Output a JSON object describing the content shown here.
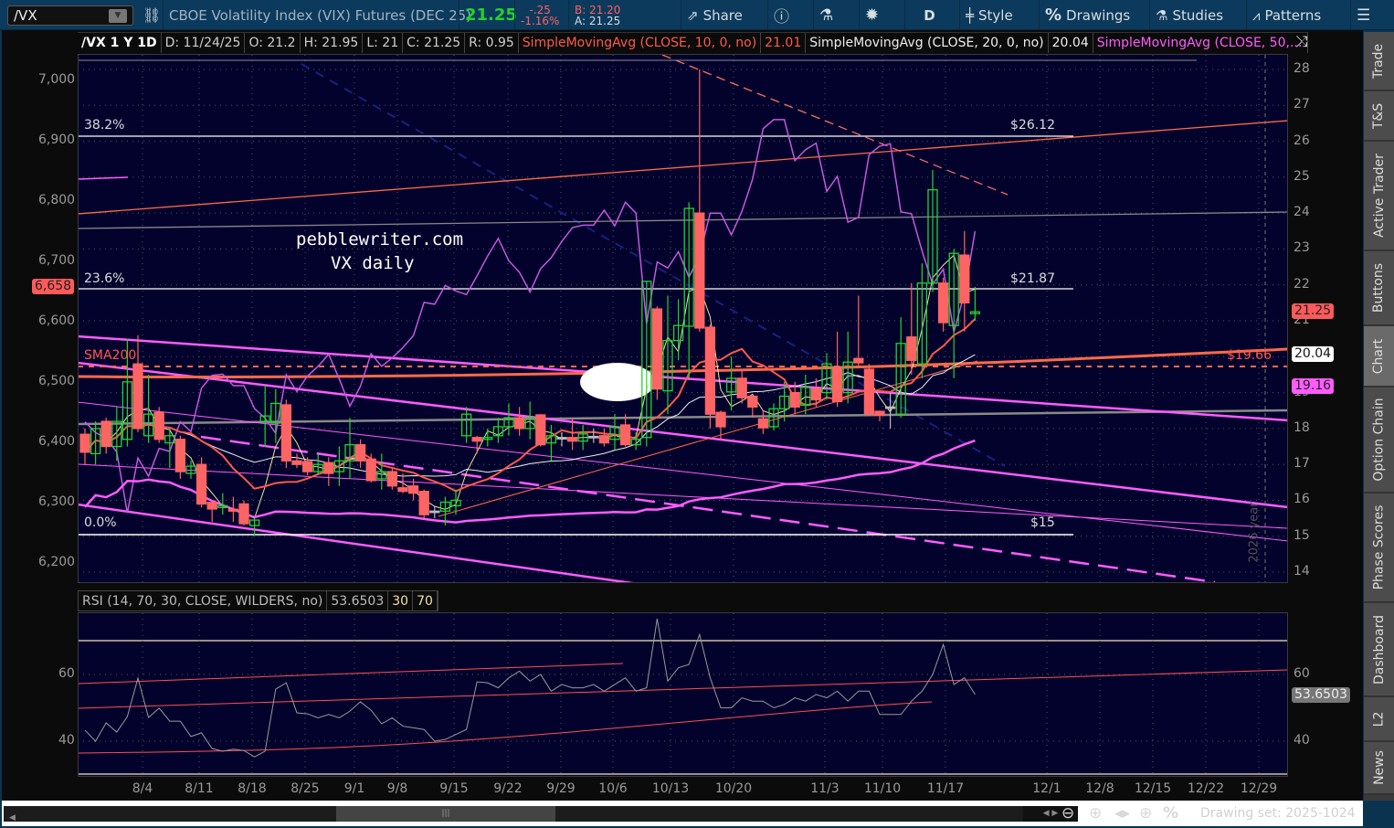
{
  "toolbar": {
    "symbol": "/VX",
    "description": "CBOE Volatility Index (VIX) Futures (DEC 25)",
    "last": "21.25",
    "change": "-.25",
    "change_pct": "-1.16%",
    "bid": "B: 21.20",
    "ask": "A: 21.25",
    "share": "Share",
    "period": "D",
    "style": "Style",
    "drawings": "Drawings",
    "studies": "Studies",
    "patterns": "Patterns"
  },
  "info": {
    "title": "/VX 1 Y 1D",
    "date": "D: 11/24/25",
    "open": "O: 21.2",
    "high": "H: 21.95",
    "low": "L: 21",
    "close": "C: 21.25",
    "range": "R: 0.95",
    "sma10_label": "SimpleMovingAvg (CLOSE, 10, 0, no)",
    "sma10_value": "21.01",
    "sma20_label": "SimpleMovingAvg (CLOSE, 20, 0, no)",
    "sma20_value": "20.04",
    "sma50_label": "SimpleMovingAvg (CLOSE, 50,..."
  },
  "colors": {
    "up": "#22d32c",
    "down": "#ff6464",
    "sma10": "#ff5a4a",
    "sma20": "#f0f0f0",
    "sma50": "#ff5cff",
    "overlay": "#c558e0",
    "bg": "#03022c"
  },
  "axes": {
    "right": [
      "28",
      "27",
      "26",
      "25",
      "24",
      "23",
      "22",
      "21",
      "20",
      "19",
      "18",
      "17",
      "16",
      "15",
      "14"
    ],
    "left": [
      "7,000",
      "6,900",
      "6,800",
      "6,700",
      "6,600",
      "6,500",
      "6,400",
      "6,300",
      "6,200"
    ],
    "rsi": [
      "60",
      "40"
    ],
    "dates": [
      "8/4",
      "8/11",
      "8/18",
      "8/25",
      "9/1",
      "9/8",
      "9/15",
      "9/22",
      "9/29",
      "10/6",
      "10/13",
      "10/20",
      "11/3",
      "11/10",
      "11/17",
      "12/1",
      "12/8",
      "12/15",
      "12/22",
      "12/29"
    ]
  },
  "badges": {
    "last": "21.25",
    "sma20": "20.04",
    "sma50": "19.16",
    "left_price": "6,658",
    "rsi": "53.6503"
  },
  "annotations": {
    "fib_382": "38.2%",
    "fib_382_price": "$26.12",
    "fib_236": "23.6%",
    "fib_236_price": "$21.87",
    "fib_0": "0.0%",
    "fib_0_price": "$15",
    "level": "$19.66",
    "sma200": "SMA200",
    "watermark1": "pebblewriter.com",
    "watermark2": "VX daily",
    "year": "2026 year"
  },
  "rsi_header": {
    "label": "RSI (14, 70, 30, CLOSE, WILDERS, no)",
    "value": "53.6503",
    "low": "30",
    "high": "70"
  },
  "chart_data": {
    "type": "candlestick",
    "symbol": "/VX",
    "ylim": [
      14,
      28
    ],
    "overlay_ylim": [
      6200,
      7000
    ],
    "candles": [
      [
        17.84,
        18.0,
        17.0,
        17.34
      ],
      [
        17.3,
        18.2,
        17.0,
        18.0
      ],
      [
        18.2,
        18.3,
        17.3,
        17.5
      ],
      [
        17.5,
        18.6,
        17.1,
        18.2
      ],
      [
        17.7,
        20.5,
        17.5,
        19.3
      ],
      [
        19.8,
        20.6,
        17.9,
        18.0
      ],
      [
        17.8,
        19.5,
        17.6,
        18.4
      ],
      [
        18.45,
        18.6,
        17.6,
        17.7
      ],
      [
        17.6,
        18.0,
        16.9,
        17.8
      ],
      [
        17.7,
        17.8,
        16.6,
        16.8
      ],
      [
        16.75,
        17.1,
        16.6,
        16.95
      ],
      [
        17.0,
        17.2,
        15.8,
        15.9
      ],
      [
        15.94,
        16.0,
        15.4,
        15.76
      ],
      [
        15.8,
        16.2,
        15.6,
        15.85
      ],
      [
        15.75,
        16.1,
        15.4,
        15.7
      ],
      [
        15.9,
        16.0,
        15.3,
        15.35
      ],
      [
        15.3,
        15.5,
        15.0,
        15.45
      ],
      [
        18.2,
        19.2,
        17.5,
        18.35
      ],
      [
        18.15,
        19.1,
        17.6,
        18.7
      ],
      [
        18.66,
        18.8,
        16.9,
        17.1
      ],
      [
        17.1,
        17.3,
        16.9,
        17.0
      ],
      [
        17.08,
        17.2,
        16.7,
        16.8
      ],
      [
        16.8,
        17.3,
        16.7,
        17.0
      ],
      [
        17.05,
        17.2,
        16.4,
        16.75
      ],
      [
        16.8,
        17.5,
        16.4,
        17.1
      ],
      [
        17.1,
        18.3,
        16.6,
        17.55
      ],
      [
        17.55,
        17.7,
        16.9,
        17.1
      ],
      [
        17.15,
        17.3,
        16.5,
        16.55
      ],
      [
        16.6,
        17.3,
        16.3,
        16.8
      ],
      [
        16.8,
        16.9,
        16.3,
        16.4
      ],
      [
        16.35,
        16.75,
        16.2,
        16.25
      ],
      [
        16.4,
        16.6,
        16.0,
        16.2
      ],
      [
        16.25,
        16.3,
        15.5,
        15.6
      ],
      [
        15.7,
        15.85,
        15.5,
        15.7
      ],
      [
        15.7,
        16.1,
        15.3,
        15.95
      ],
      [
        15.85,
        16.3,
        15.6,
        16.0
      ],
      [
        17.8,
        18.6,
        17.6,
        18.4
      ],
      [
        17.75,
        17.8,
        17.3,
        17.65
      ],
      [
        17.7,
        18.0,
        17.5,
        17.75
      ],
      [
        17.8,
        18.3,
        17.6,
        18.05
      ],
      [
        18.05,
        18.7,
        17.8,
        18.3
      ],
      [
        18.3,
        18.6,
        17.8,
        18.0
      ],
      [
        18.0,
        18.75,
        17.7,
        18.3
      ],
      [
        18.38,
        18.4,
        17.5,
        17.55
      ],
      [
        17.6,
        18.1,
        17.1,
        17.8
      ],
      [
        17.75,
        17.9,
        17.5,
        17.75
      ],
      [
        17.75,
        18.3,
        17.4,
        17.65
      ],
      [
        17.65,
        18.1,
        17.4,
        17.85
      ],
      [
        17.78,
        18.0,
        17.6,
        17.78
      ],
      [
        17.8,
        18.0,
        17.5,
        17.6
      ],
      [
        17.7,
        18.4,
        17.4,
        18.05
      ],
      [
        18.1,
        18.4,
        17.5,
        17.55
      ],
      [
        17.55,
        17.9,
        17.4,
        17.7
      ],
      [
        17.75,
        22.1,
        17.5,
        22.1
      ],
      [
        21.33,
        21.4,
        18.8,
        19.1
      ],
      [
        19.05,
        21.7,
        18.4,
        20.45
      ],
      [
        20.45,
        21.6,
        19.9,
        20.87
      ],
      [
        20.85,
        24.3,
        19.4,
        24.13
      ],
      [
        24.0,
        28.0,
        20.7,
        20.8
      ],
      [
        20.82,
        20.9,
        18.0,
        18.4
      ],
      [
        18.45,
        18.5,
        17.7,
        18.05
      ],
      [
        19.02,
        20.0,
        18.5,
        19.4
      ],
      [
        19.4,
        19.6,
        18.7,
        18.86
      ],
      [
        18.9,
        18.9,
        18.3,
        18.6
      ],
      [
        18.27,
        18.5,
        17.85,
        18.02
      ],
      [
        18.05,
        18.7,
        17.95,
        18.55
      ],
      [
        18.55,
        19.3,
        18.2,
        18.9
      ],
      [
        19.0,
        19.3,
        18.4,
        18.6
      ],
      [
        18.65,
        19.5,
        18.4,
        19.15
      ],
      [
        19.1,
        19.4,
        18.6,
        18.8
      ],
      [
        19.0,
        20.1,
        18.8,
        19.8
      ],
      [
        19.72,
        20.7,
        18.6,
        18.75
      ],
      [
        19.0,
        20.7,
        18.7,
        19.85
      ],
      [
        19.95,
        21.7,
        19.7,
        19.83
      ],
      [
        19.65,
        19.8,
        18.35,
        18.4
      ],
      [
        18.48,
        18.5,
        18.2,
        18.37
      ],
      [
        18.6,
        19.0,
        18.0,
        18.6
      ],
      [
        18.4,
        21.1,
        18.3,
        20.37
      ],
      [
        20.55,
        22.05,
        19.5,
        19.9
      ],
      [
        19.8,
        22.6,
        19.4,
        22.05
      ],
      [
        22.05,
        25.2,
        21.8,
        24.65
      ],
      [
        22.05,
        22.2,
        20.7,
        20.95
      ],
      [
        20.87,
        23.0,
        19.4,
        22.88
      ],
      [
        22.83,
        23.5,
        20.7,
        21.5
      ],
      [
        21.2,
        21.95,
        21.0,
        21.25
      ]
    ],
    "overlay_series": [
      6434,
      6416,
      6407,
      6384,
      6283,
      6374,
      6344,
      6390,
      6385,
      6434,
      6418,
      6490,
      6511,
      6513,
      6494,
      6494,
      6456,
      6440,
      6415,
      6512,
      6484,
      6510,
      6526,
      6546,
      6505,
      6460,
      6493,
      6547,
      6526,
      6540,
      6557,
      6577,
      6632,
      6629,
      6660,
      6651,
      6645,
      6676,
      6709,
      6738,
      6701,
      6682,
      6649,
      6688,
      6706,
      6733,
      6756,
      6760,
      6760,
      6785,
      6759,
      6798,
      6780,
      6597,
      6699,
      6689,
      6716,
      6674,
      6709,
      6780,
      6780,
      6744,
      6783,
      6836,
      6920,
      6935,
      6935,
      6867,
      6885,
      6896,
      6816,
      6841,
      6765,
      6773,
      6877,
      6891,
      6895,
      6782,
      6779,
      6717,
      6662,
      6687,
      6583,
      6647,
      6750
    ],
    "rsi": [
      43.3,
      40,
      45.5,
      42.7,
      47.4,
      58.9,
      47.1,
      49.9,
      46,
      46,
      41.4,
      42.5,
      37.8,
      37,
      37.6,
      37.2,
      35.3,
      37,
      55.6,
      57.5,
      48.5,
      48.2,
      47,
      48,
      47,
      49,
      51.8,
      49.3,
      45.2,
      47,
      44.5,
      44,
      43.5,
      40,
      40.5,
      42,
      43.5,
      57.8,
      57.5,
      56,
      59,
      61,
      58,
      60,
      55,
      57,
      56,
      56,
      57,
      55,
      57,
      59,
      55,
      56,
      76.7,
      58,
      62,
      63,
      72,
      59,
      50,
      50,
      53,
      52,
      52,
      50,
      51,
      53,
      52,
      54,
      53,
      55,
      52,
      55,
      55,
      48,
      48,
      48,
      52,
      55,
      60,
      69,
      57,
      59,
      54
    ],
    "rsi_levels": [
      30,
      70
    ]
  },
  "side_tabs": [
    "Trade",
    "T&S",
    "Active Trader",
    "Buttons",
    "Chart",
    "Option Chain",
    "Phase Scores",
    "Dashboard",
    "L2",
    "News"
  ],
  "footer": {
    "drawing_set": "Drawing set: 2025-1024"
  }
}
